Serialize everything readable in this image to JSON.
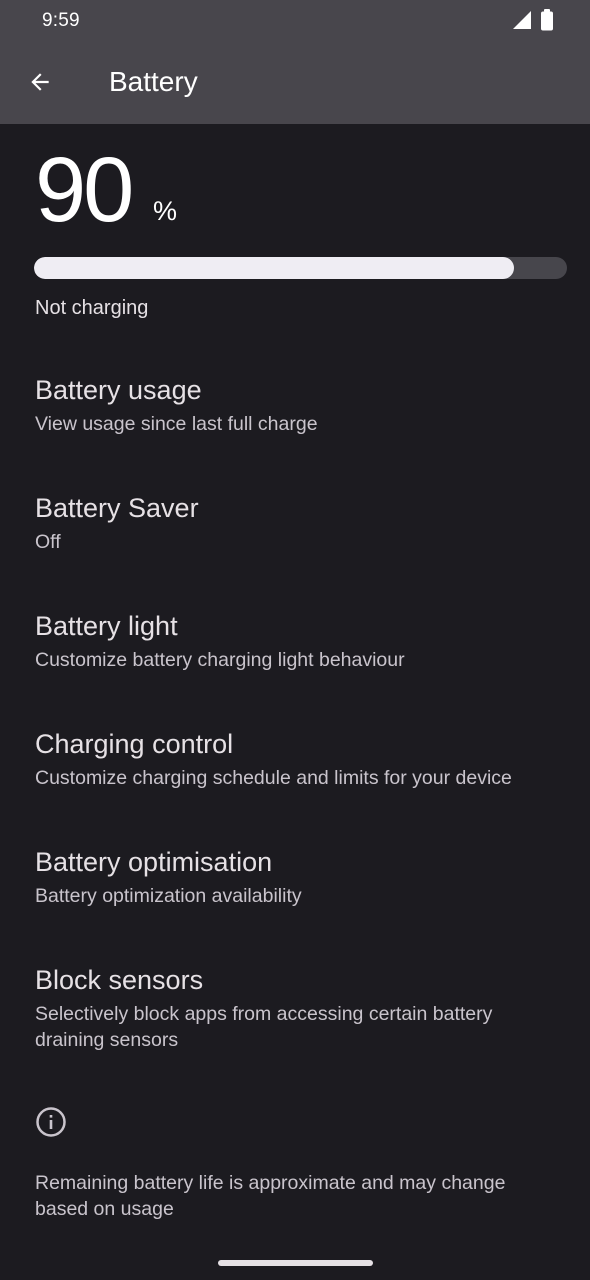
{
  "status_bar": {
    "time": "9:59",
    "icons": [
      "signal-icon",
      "battery-icon"
    ]
  },
  "app_bar": {
    "back_icon": "arrow-left-icon",
    "title": "Battery"
  },
  "battery": {
    "level": "90",
    "percent_sign": "%",
    "level_fraction": 0.9,
    "status": "Not charging"
  },
  "preferences": [
    {
      "title": "Battery usage",
      "summary": "View usage since last full charge"
    },
    {
      "title": "Battery Saver",
      "summary": "Off"
    },
    {
      "title": "Battery light",
      "summary": "Customize battery charging light behaviour"
    },
    {
      "title": "Charging control",
      "summary": "Customize charging schedule and limits for your device"
    },
    {
      "title": "Battery optimisation",
      "summary": "Battery optimization availability"
    },
    {
      "title": "Block sensors",
      "summary": "Selectively block apps from accessing certain battery draining sensors"
    }
  ],
  "footer": {
    "icon": "info-icon",
    "note": "Remaining battery life is approximate and may change based on usage"
  },
  "colors": {
    "bar_background": "#48464c",
    "page_background": "#1c1b20",
    "progress_fill": "#efedf3",
    "progress_track": "#47464c"
  }
}
